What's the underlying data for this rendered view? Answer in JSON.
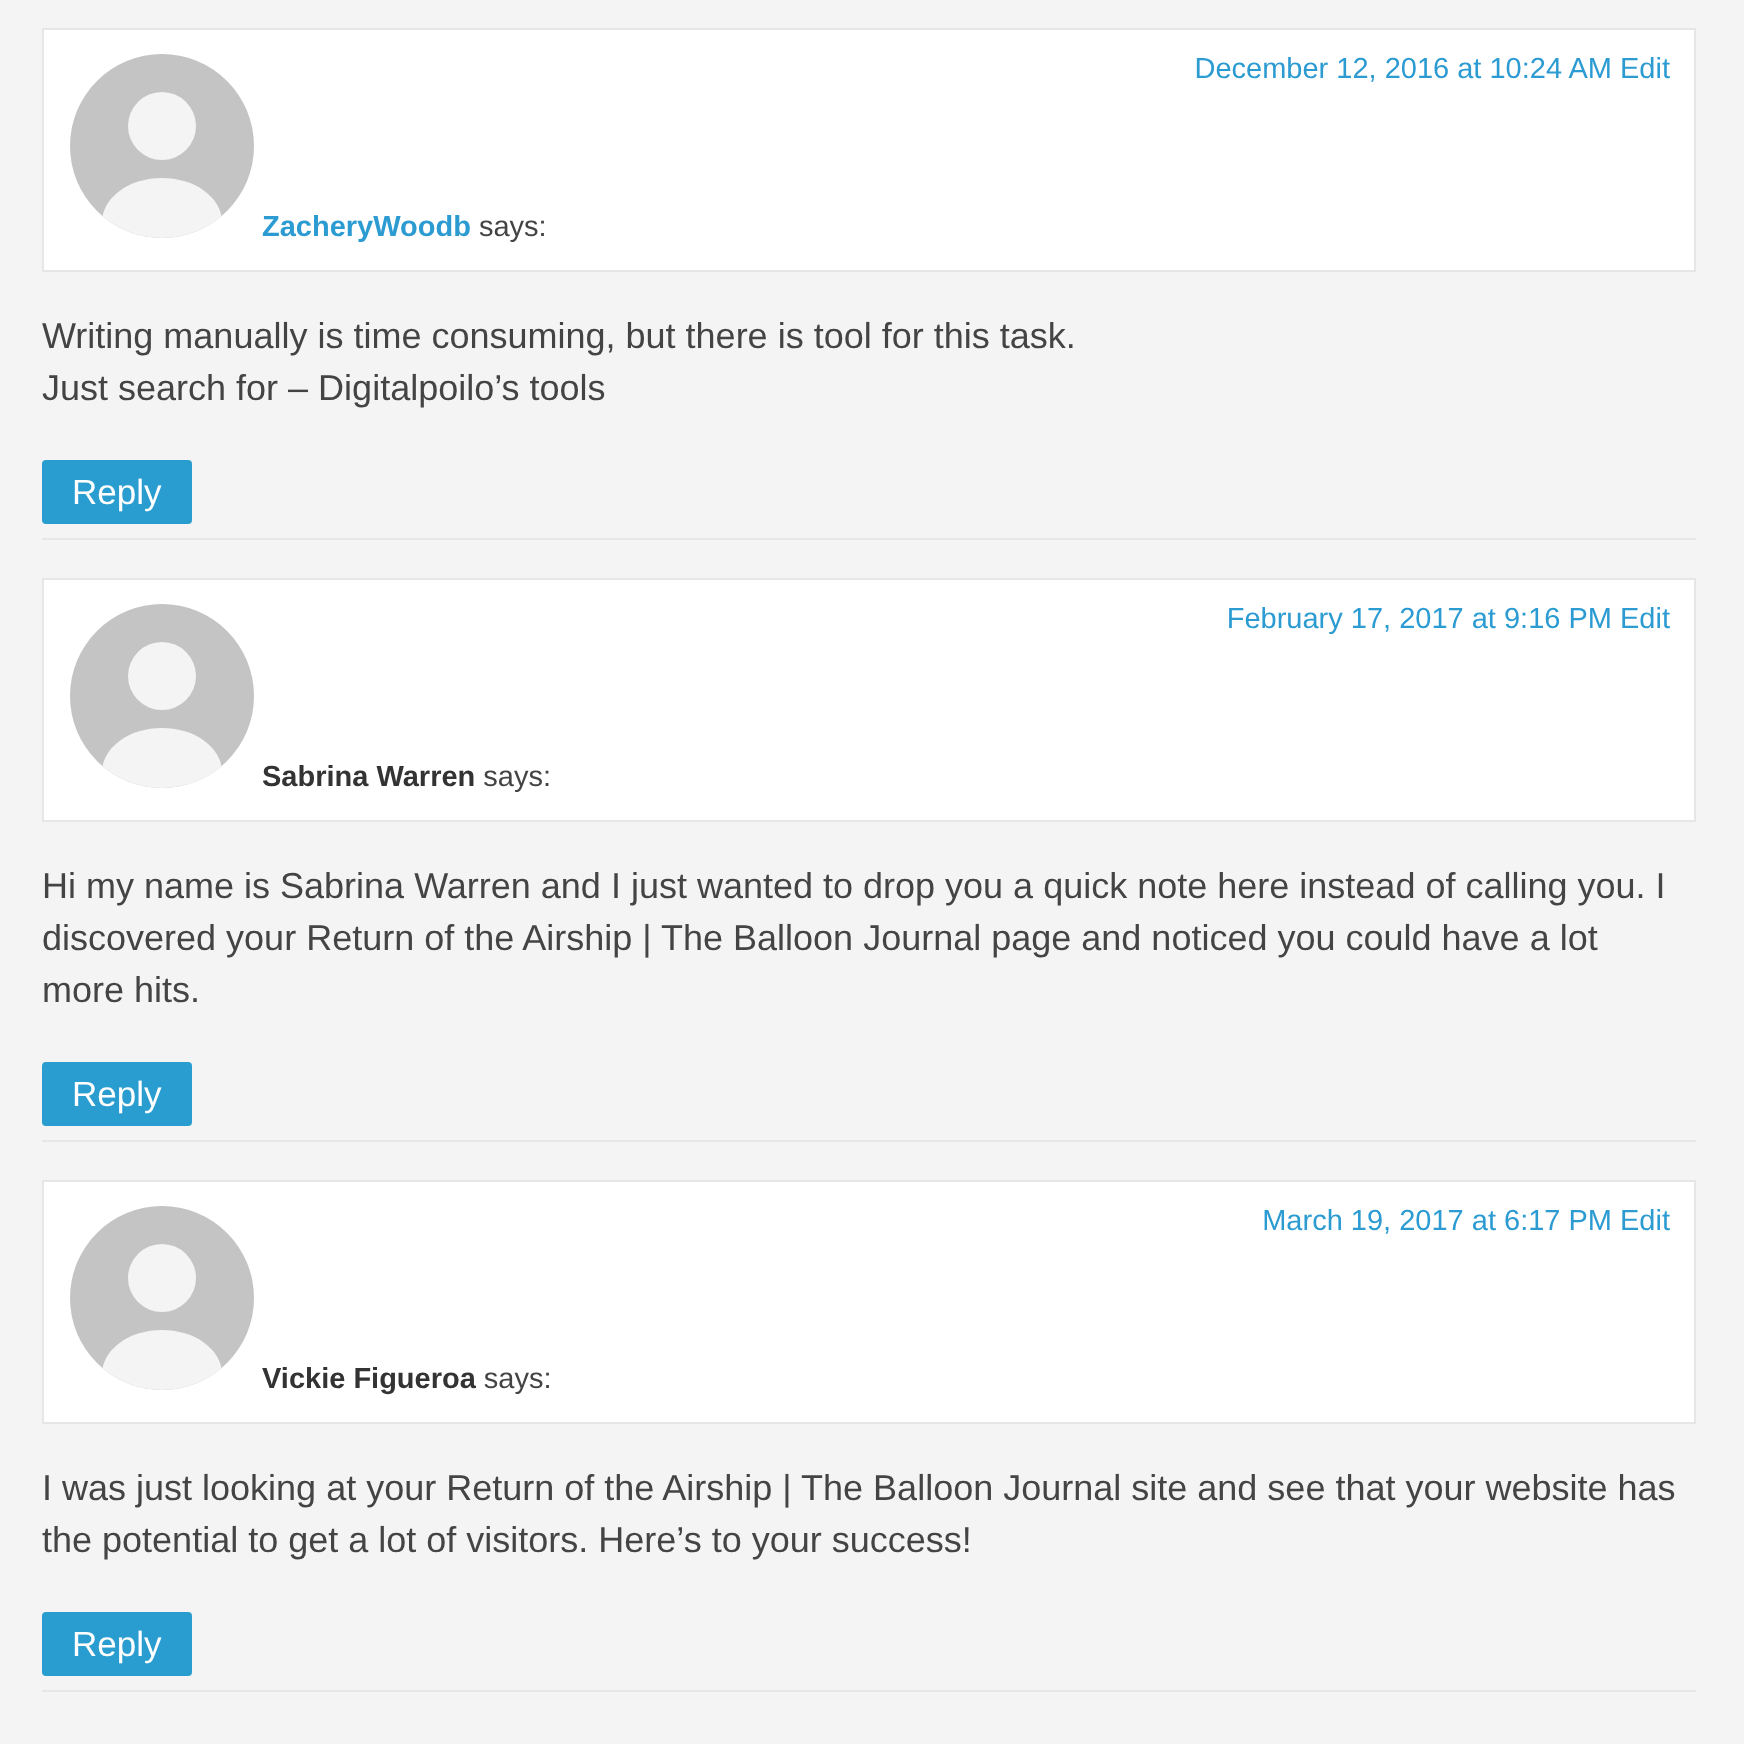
{
  "comments": [
    {
      "author": "ZacheryWoodb",
      "author_linked": true,
      "says": "says:",
      "date": "December 12, 2016 at 10:24 AM",
      "edit": "Edit",
      "paragraphs": [
        "Writing manually is time consuming, but there is tool for this task.\nJust search for – Digitalpoilo’s tools"
      ],
      "reply": "Reply"
    },
    {
      "author": "Sabrina Warren",
      "author_linked": false,
      "says": "says:",
      "date": "February 17, 2017 at 9:16 PM",
      "edit": "Edit",
      "paragraphs": [
        "Hi my name is Sabrina Warren and I just wanted to drop you a quick note here instead of calling you. I discovered your Return of the Airship | The Balloon Journal page and noticed you could have a lot more hits."
      ],
      "reply": "Reply"
    },
    {
      "author": "Vickie Figueroa",
      "author_linked": false,
      "says": "says:",
      "date": "March 19, 2017 at 6:17 PM",
      "edit": "Edit",
      "paragraphs": [
        "I was just looking at your Return of the Airship | The Balloon Journal site and see that your website has the potential to get a lot of visitors. Here’s to your success!"
      ],
      "reply": "Reply"
    }
  ]
}
